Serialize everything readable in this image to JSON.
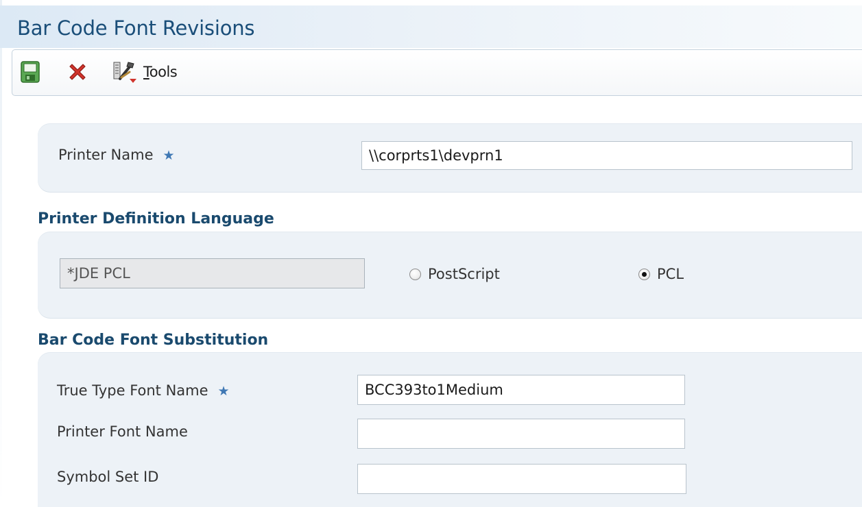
{
  "window": {
    "title": "Bar Code Font Revisions"
  },
  "toolbar": {
    "save_icon": "save-icon",
    "cancel_icon": "cancel-icon",
    "tools_icon": "tools-icon",
    "tools_label_mnemonic": "T",
    "tools_label_rest": "ools"
  },
  "printer": {
    "name_label": "Printer Name",
    "required_mark": "★",
    "name_value": "\\\\corprts1\\devprn1"
  },
  "pdl": {
    "section_title": "Printer Definition Language",
    "current_value": "*JDE PCL",
    "options": [
      {
        "label": "PostScript",
        "selected": false
      },
      {
        "label": "PCL",
        "selected": true
      }
    ]
  },
  "substitution": {
    "section_title": "Bar Code Font Substitution",
    "ttf_label": "True Type Font Name",
    "required_mark": "★",
    "ttf_value": "BCC393to1Medium",
    "printer_font_label": "Printer Font Name",
    "printer_font_value": "",
    "symbol_set_label": "Symbol Set ID",
    "symbol_set_value": ""
  },
  "colors": {
    "title": "#1a4e79",
    "section_title": "#1a4a6e",
    "panel": "#edf2f7",
    "required_star": "#3f78b4",
    "cancel_red": "#d0342c",
    "save_green": "#4c9a45"
  }
}
